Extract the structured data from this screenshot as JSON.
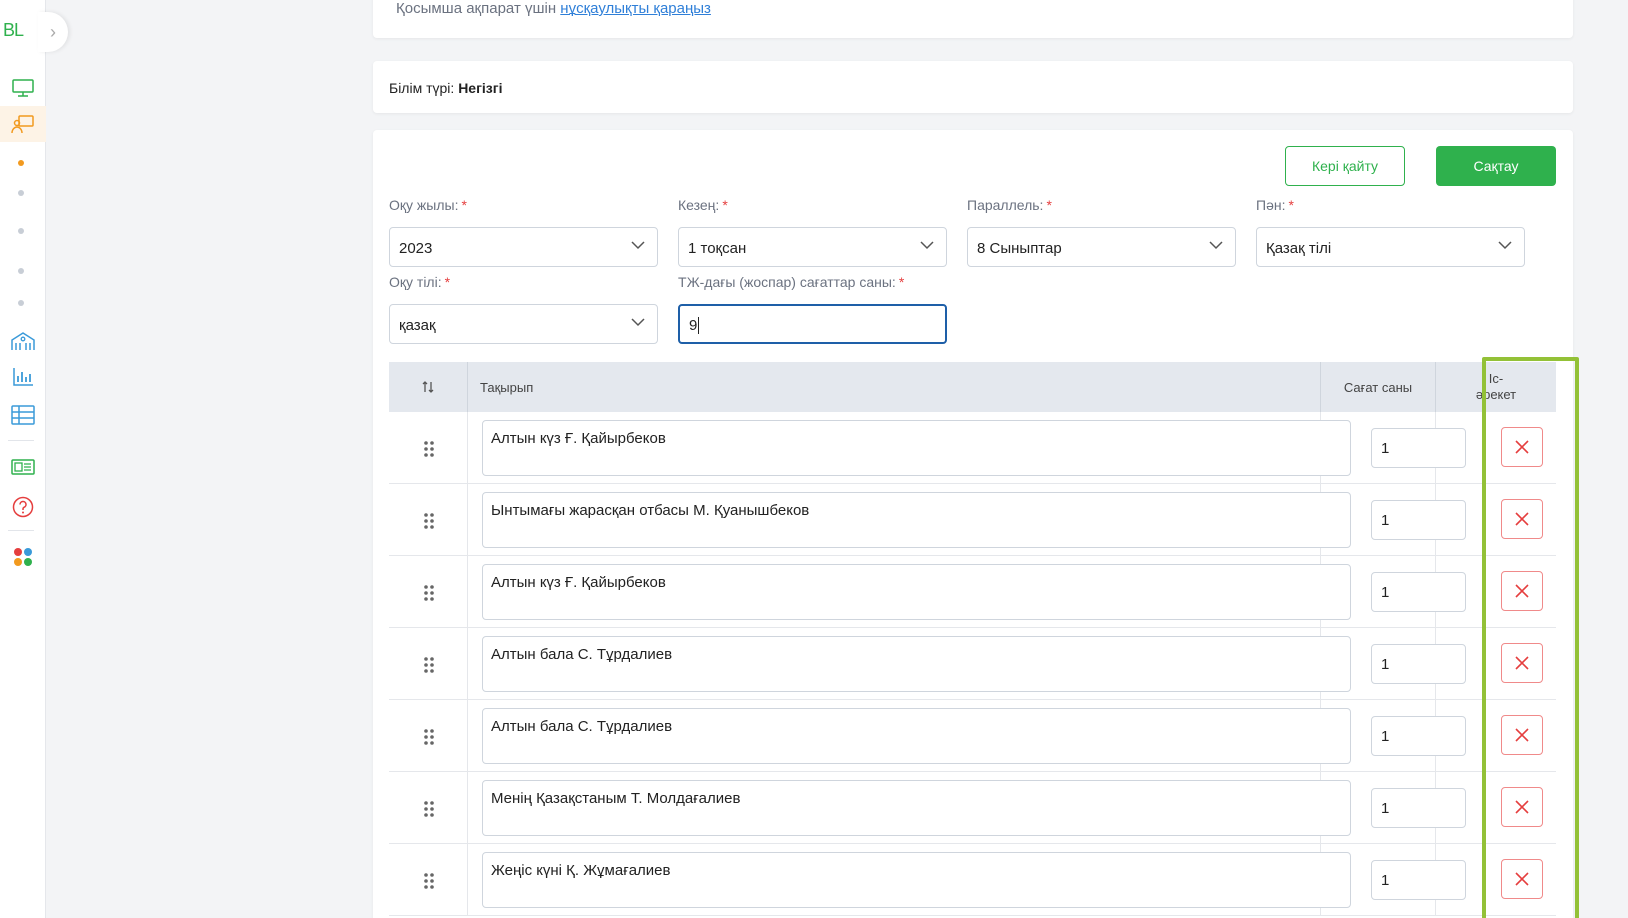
{
  "sidebar": {
    "logo": "BL",
    "collapse_icon": "chevron-right-icon",
    "items": [
      {
        "icon": "monitor-icon"
      },
      {
        "icon": "teacher-board-icon",
        "active": true
      },
      {
        "icon": "school-building-icon"
      },
      {
        "icon": "bar-chart-icon"
      },
      {
        "icon": "table-grid-icon"
      },
      {
        "icon": "journal-icon"
      },
      {
        "icon": "help-icon"
      },
      {
        "icon": "apps-icon"
      }
    ],
    "accent": "#f29a1f"
  },
  "info": {
    "text": "Қосымша ақпарат үшін ",
    "link": "нұсқаулықты қараңыз"
  },
  "education_type": {
    "label": "Білім түрі:",
    "value": "Негізгі"
  },
  "actions": {
    "back_label": "Кері қайту",
    "save_label": "Сақтау"
  },
  "form": {
    "year": {
      "label": "Оқу жылы:",
      "value": "2023"
    },
    "period": {
      "label": "Кезең:",
      "value": "1 тоқсан"
    },
    "parallel": {
      "label": "Параллель:",
      "value": "8 Сыныптар"
    },
    "subject": {
      "label": "Пән:",
      "value": "Қазақ тілі"
    },
    "language": {
      "label": "Оқу тілі:",
      "value": "қазақ"
    },
    "planned_hours": {
      "label": "ТЖ-дағы (жоспар) сағаттар саны:",
      "value": "9"
    },
    "required_mark": "*"
  },
  "table": {
    "headers": {
      "sort": "sort-arrows-icon",
      "topic": "Тақырып",
      "hours": "Сағат саны",
      "action_line1": "Іс-",
      "action_line2": "әрекет"
    },
    "rows": [
      {
        "topic": "Алтын күз Ғ. Қайырбеков",
        "hours": "1"
      },
      {
        "topic": "Ынтымағы жарасқан отбасы М. Қуанышбеков",
        "hours": "1"
      },
      {
        "topic": "Алтын күз Ғ. Қайырбеков",
        "hours": "1"
      },
      {
        "topic": "Алтын бала С. Тұрдалиев",
        "hours": "1"
      },
      {
        "topic": "Алтын бала С. Тұрдалиев",
        "hours": "1"
      },
      {
        "topic": "Менің Қазақстаным Т. Молдағалиев",
        "hours": "1"
      },
      {
        "topic": "Жеңіс күні Қ. Жұмағалиев",
        "hours": "1"
      }
    ]
  },
  "colors": {
    "primary": "#2fb14d",
    "danger": "#e53e3e",
    "highlight": "#93c137",
    "link": "#2f7fd8"
  }
}
